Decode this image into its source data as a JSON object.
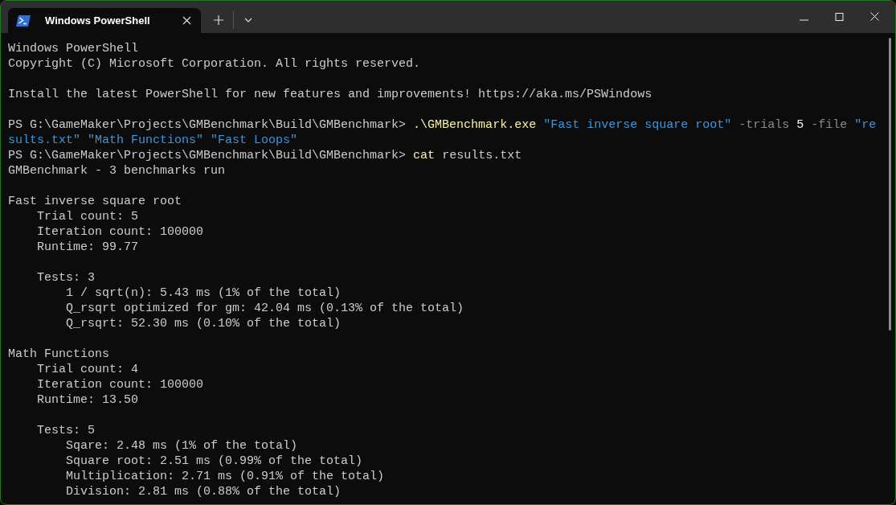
{
  "window": {
    "tab_title": "Windows PowerShell"
  },
  "blocks": [
    {
      "lines": [
        {
          "text": "Windows PowerShell"
        },
        {
          "text": "Copyright (C) Microsoft Corporation. All rights reserved."
        }
      ]
    },
    {
      "lines": [
        {
          "text": "Install the latest PowerShell for new features and improvements! https://aka.ms/PSWindows"
        }
      ]
    },
    {
      "lines": [
        {
          "segments": [
            {
              "kind": "prompt",
              "text": "PS G:\\GameMaker\\Projects\\GMBenchmark\\Build\\GMBenchmark>"
            },
            {
              "kind": "command",
              "text": ".\\GMBenchmark.exe"
            },
            {
              "kind": "string",
              "text": "\"Fast inverse square root\""
            },
            {
              "kind": "parameter",
              "text": "-trials"
            },
            {
              "kind": "number",
              "text": "5"
            },
            {
              "kind": "parameter",
              "text": "-file"
            },
            {
              "kind": "string",
              "text": "\"re"
            }
          ]
        },
        {
          "segments": [
            {
              "kind": "string",
              "text": "sults.txt\""
            },
            {
              "kind": "string",
              "text": "\"Math Functions\""
            },
            {
              "kind": "string",
              "text": "\"Fast Loops\""
            }
          ]
        },
        {
          "segments": [
            {
              "kind": "prompt",
              "text": "PS G:\\GameMaker\\Projects\\GMBenchmark\\Build\\GMBenchmark>"
            },
            {
              "kind": "command",
              "text": "cat"
            },
            {
              "kind": "argument",
              "text": "results.txt"
            }
          ]
        },
        {
          "text": "GMBenchmark - 3 benchmarks run"
        }
      ]
    },
    {
      "lines": [
        {
          "text": "Fast inverse square root",
          "children": [
            {
              "lines": [
                {
                  "text": "Trial count: 5"
                },
                {
                  "text": "Iteration count: 100000"
                },
                {
                  "text": "Runtime: 99.77"
                }
              ]
            },
            {
              "lines": [
                {
                  "text": "Tests: 3",
                  "children": [
                    {
                      "lines": [
                        {
                          "text": "1 / sqrt(n): 5.43 ms (1% of the total)"
                        },
                        {
                          "text": "Q_rsqrt optimized for gm: 42.04 ms (0.13% of the total)"
                        },
                        {
                          "text": "Q_rsqrt: 52.30 ms (0.10% of the total)"
                        }
                      ]
                    }
                  ]
                }
              ]
            }
          ]
        }
      ]
    },
    {
      "lines": [
        {
          "text": "Math Functions",
          "children": [
            {
              "lines": [
                {
                  "text": "Trial count: 4"
                },
                {
                  "text": "Iteration count: 100000"
                },
                {
                  "text": "Runtime: 13.50"
                }
              ]
            },
            {
              "lines": [
                {
                  "text": "Tests: 5",
                  "children": [
                    {
                      "lines": [
                        {
                          "text": "Sqare: 2.48 ms (1% of the total)"
                        },
                        {
                          "text": "Square root: 2.51 ms (0.99% of the total)"
                        },
                        {
                          "text": "Multiplication: 2.71 ms (0.91% of the total)"
                        },
                        {
                          "text": "Division: 2.81 ms (0.88% of the total)"
                        }
                      ]
                    }
                  ]
                }
              ]
            }
          ]
        }
      ]
    }
  ]
}
